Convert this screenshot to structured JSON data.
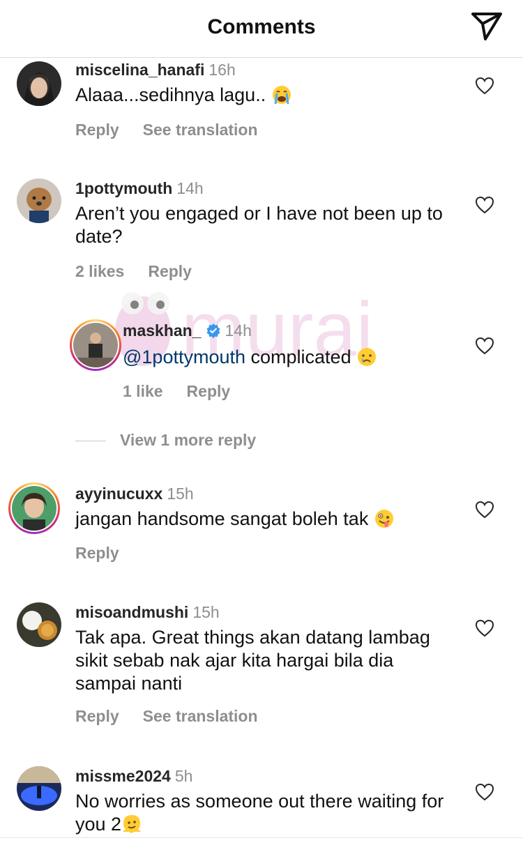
{
  "header": {
    "title": "Comments"
  },
  "comments": [
    {
      "username": "miscelina_hanafi",
      "time": "16h",
      "text": "Alaaa...sedihnya lagu..",
      "emoji": "loudly-crying-face",
      "actions": [
        "Reply",
        "See translation"
      ]
    },
    {
      "username": "1pottymouth",
      "time": "14h",
      "text": "Aren’t you engaged or I have not been up to date?",
      "actions": [
        "2 likes",
        "Reply"
      ]
    },
    {
      "username": "maskhan_",
      "time": "14h",
      "verified": true,
      "mention": "@1pottymouth",
      "text": " complicated",
      "emoji": "crying-face",
      "actions": [
        "1 like",
        "Reply"
      ]
    },
    {
      "username": "ayyinucuxx",
      "time": "15h",
      "text": "jangan handsome sangat boleh tak",
      "emoji": "zany-face",
      "actions": [
        "Reply"
      ]
    },
    {
      "username": "misoandmushi",
      "time": "15h",
      "text": "Tak apa. Great things akan datang lambag sikit sebab nak ajar kita hargai bila dia sampai nanti",
      "actions": [
        "Reply",
        "See translation"
      ]
    },
    {
      "username": "missme2024",
      "time": "5h",
      "text": "No worries as someone out there waiting for you 2",
      "emoji": "melting-face",
      "actions": []
    }
  ],
  "view_more_replies": "View 1 more reply",
  "watermark": {
    "text": "murai"
  },
  "colors": {
    "username": "#262626",
    "secondary": "#8e8e8e",
    "mention": "#00376b",
    "verified": "#3897f0"
  }
}
